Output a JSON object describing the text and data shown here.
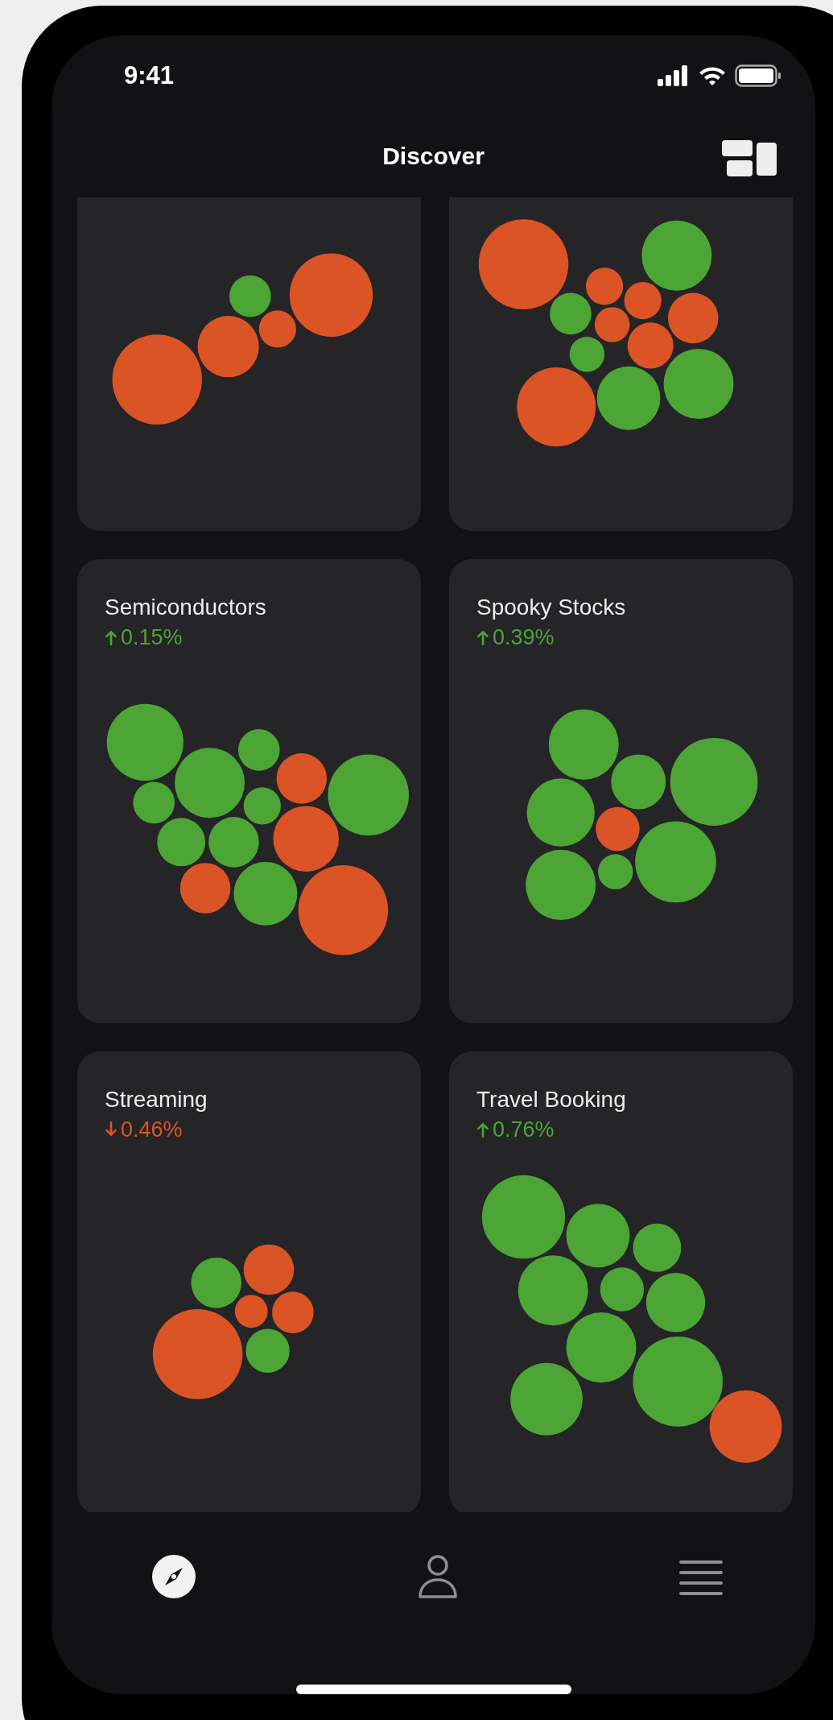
{
  "status_bar": {
    "time": "9:41"
  },
  "header": {
    "title": "Discover"
  },
  "cards": [
    {
      "kind": "chart"
    },
    {
      "kind": "chart"
    },
    {
      "kind": "up",
      "title": "Semiconductors",
      "change": "0.15%"
    },
    {
      "kind": "up",
      "title": "Spooky Stocks",
      "change": "0.39%"
    },
    {
      "kind": "down",
      "title": "Streaming",
      "change": "0.46%"
    },
    {
      "kind": "up",
      "title": "Travel Booking",
      "change": "0.76%"
    }
  ],
  "tab_bar": [
    {
      "kind": "compass",
      "selected": true
    },
    {
      "kind": "person",
      "selected": false
    },
    {
      "kind": "menu",
      "selected": false
    }
  ]
}
